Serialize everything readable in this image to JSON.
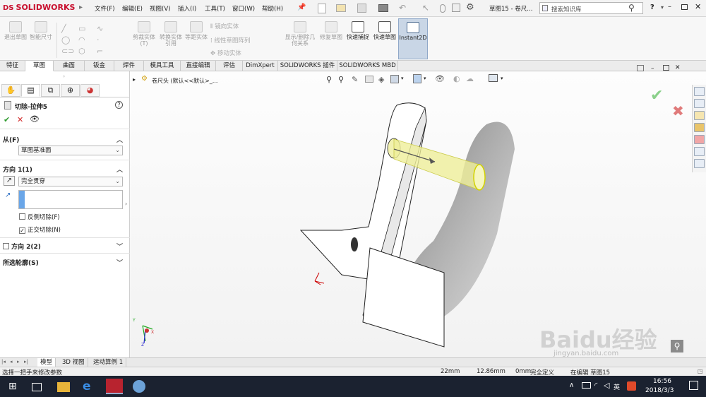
{
  "app": {
    "logo": "SOLIDWORKS",
    "logo_mark": "DS",
    "doc_title": "草图15 - 卷尺...",
    "search_placeholder": "搜索知识库",
    "help": "?",
    "menus": [
      "文件(F)",
      "编辑(E)",
      "视图(V)",
      "插入(I)",
      "工具(T)",
      "窗口(W)",
      "帮助(H)"
    ]
  },
  "ribbon": {
    "buttons": [
      "退出草图",
      "智能尺寸",
      "剪裁实体(T)",
      "转换实体引用",
      "等距实体",
      "镜向实体",
      "线性草图阵列",
      "移动实体",
      "显示/删除几何关系",
      "修复草图",
      "快速捕捉",
      "快速草图",
      "Instant2D"
    ]
  },
  "command_tabs": [
    "特征",
    "草图",
    "曲面",
    "钣金",
    "焊件",
    "模具工具",
    "直接编辑",
    "评估",
    "DimXpert",
    "SOLIDWORKS 插件",
    "SOLIDWORKS MBD"
  ],
  "property_manager": {
    "title": "切除-拉伸5",
    "from_label": "从(F)",
    "from_value": "草图基准面",
    "dir1_label": "方向 1(1)",
    "dir1_value": "完全贯穿",
    "flip_side_cut": "反侧切除(F)",
    "normal_cut": "正交切除(N)",
    "dir2_label": "方向 2(2)",
    "selected_contours": "所选轮廓(S)"
  },
  "tree": {
    "breadcrumb": "卷尺头 (默认<<默认>_..."
  },
  "bottom_tabs": [
    "模型",
    "3D 视图",
    "运动算例 1"
  ],
  "status": {
    "hint": "选择一把手来修改参数",
    "x": "22mm",
    "y": "12.86mm",
    "z": "0mm",
    "state": "完全定义",
    "editing": "在编辑 草图15"
  },
  "taskbar": {
    "time": "16:56",
    "date": "2018/3/3",
    "ime": "英"
  },
  "watermark": {
    "text": "Baidu经验",
    "url": "jingyan.baidu.com"
  },
  "colors": {
    "accent_red": "#c8102e",
    "confirm_green": "#2e9b2e",
    "cancel_red": "#d22a2a",
    "extrude_yellow": "#efef9a"
  }
}
